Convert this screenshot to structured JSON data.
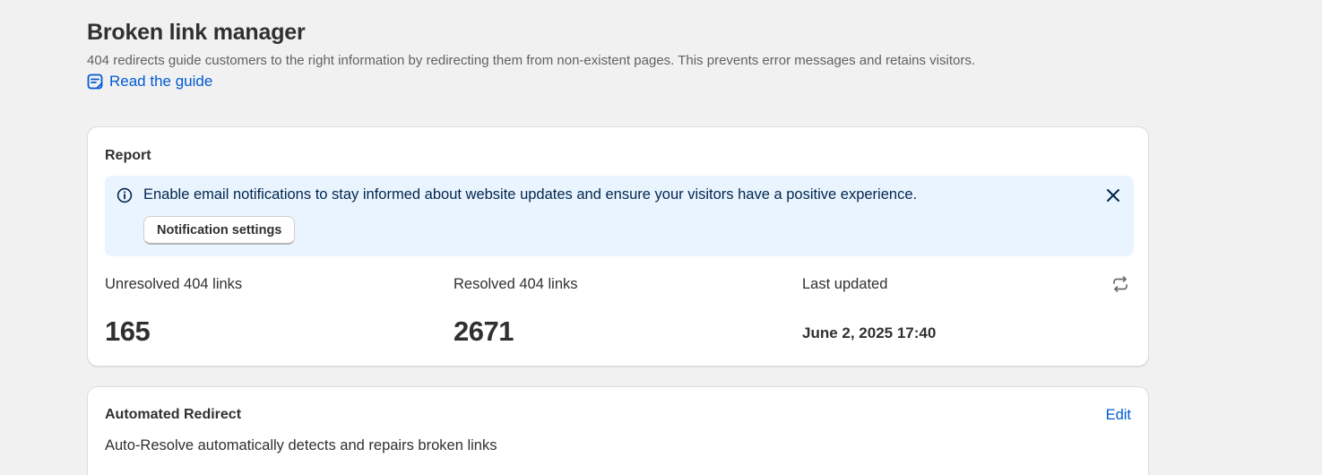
{
  "header": {
    "title": "Broken link manager",
    "subtitle": "404 redirects guide customers to the right information by redirecting them from non-existent pages. This prevents error messages and retains visitors.",
    "guide_link": {
      "label": "Read the guide",
      "icon": "guide-icon"
    }
  },
  "report": {
    "heading": "Report",
    "banner": {
      "icon": "info-icon",
      "text": "Enable email notifications to stay informed about website updates and ensure your visitors have a positive experience.",
      "button_label": "Notification settings",
      "close_icon": "close-icon"
    },
    "stats": [
      {
        "label": "Unresolved 404 links",
        "value": "165"
      },
      {
        "label": "Resolved 404 links",
        "value": "2671"
      },
      {
        "label": "Last updated",
        "value": "June 2, 2025 17:40"
      }
    ],
    "refresh_icon": "refresh-icon"
  },
  "automated_redirect": {
    "heading": "Automated Redirect",
    "edit_label": "Edit",
    "description": "Auto-Resolve automatically detects and repairs broken links"
  },
  "colors": {
    "background": "#f1f1f1",
    "link": "#005bd3",
    "banner_bg": "#eaf4ff",
    "text": "#303030"
  }
}
